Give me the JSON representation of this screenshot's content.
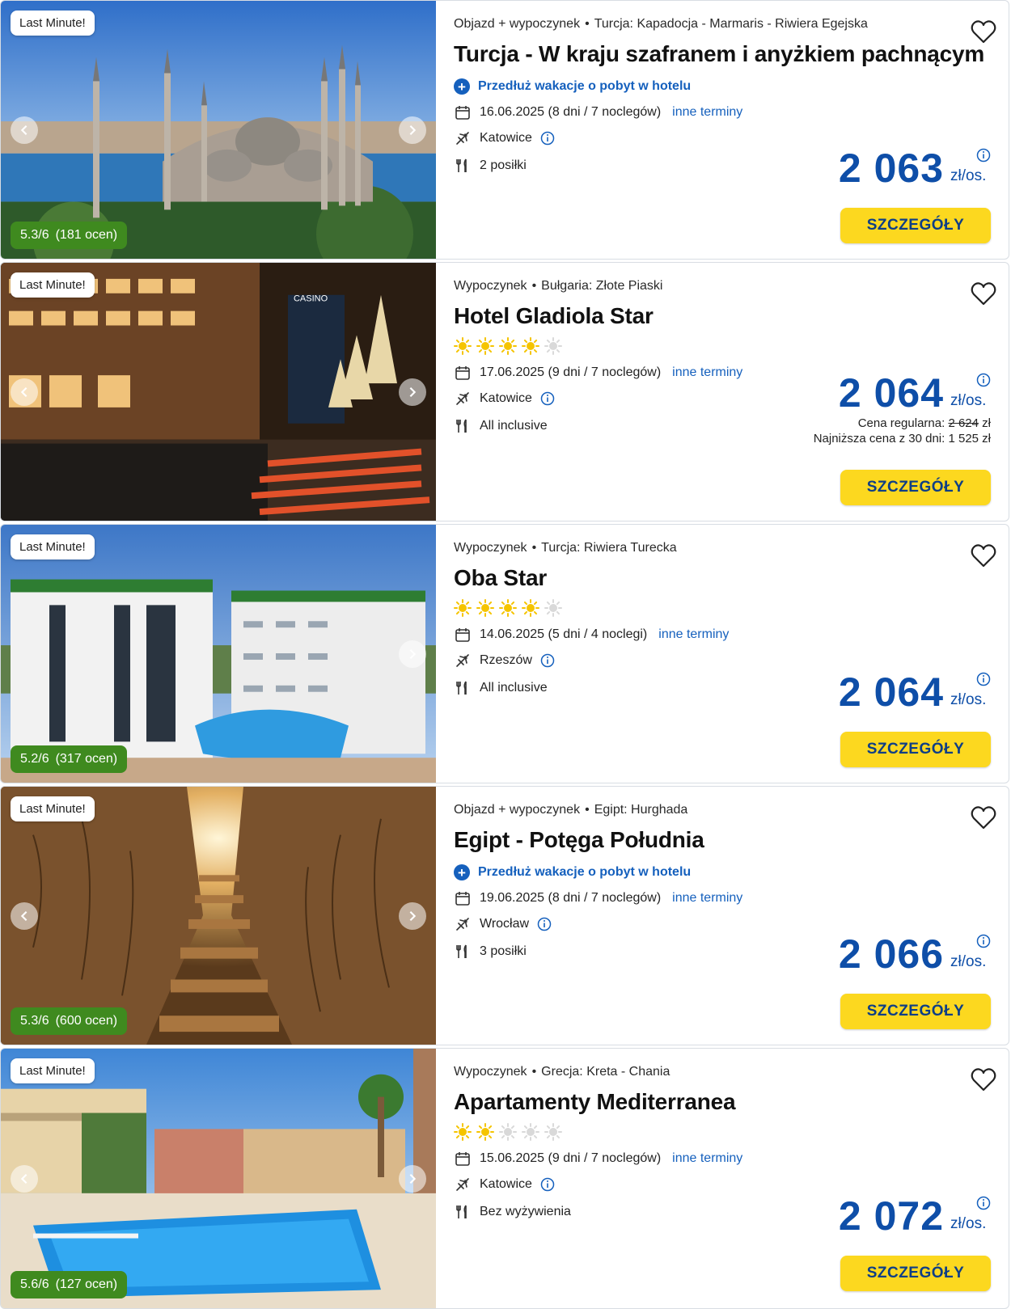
{
  "common": {
    "badge": "Last Minute!",
    "details_label": "SZCZEGÓŁY",
    "other_dates_label": "inne terminy",
    "per_person_label": "zł/os.",
    "extend_label": "Przedłuż wakacje o pobyt w hotelu",
    "dot": "•"
  },
  "offers": [
    {
      "type": "Objazd + wypoczynek",
      "destination": "Turcja: Kapadocja - Marmaris - Riwiera Egejska",
      "title": "Turcja - W kraju szafranem i anyżkiem pachnącym",
      "stars": 0,
      "extend": true,
      "date": "16.06.2025 (8 dni / 7 noclegów)",
      "departure": "Katowice",
      "meals": "2 posiłki",
      "price": "2 063",
      "rating": "5.3/6",
      "rating_count": "(181 ocen)",
      "regular_price_label": "",
      "regular_price": "",
      "lowest_price": ""
    },
    {
      "type": "Wypoczynek",
      "destination": "Bułgaria: Złote Piaski",
      "title": "Hotel Gladiola Star",
      "stars": 4,
      "extend": false,
      "date": "17.06.2025 (9 dni / 7 noclegów)",
      "departure": "Katowice",
      "meals": "All inclusive",
      "price": "2 064",
      "rating": "",
      "rating_count": "",
      "regular_price_label": "Cena regularna:",
      "regular_price": "2 624",
      "regular_price_currency": "zł",
      "lowest_price": "Najniższa cena z 30 dni: 1 525 zł"
    },
    {
      "type": "Wypoczynek",
      "destination": "Turcja: Riwiera Turecka",
      "title": "Oba Star",
      "stars": 4,
      "extend": false,
      "date": "14.06.2025 (5 dni / 4 noclegi)",
      "departure": "Rzeszów",
      "meals": "All inclusive",
      "price": "2 064",
      "rating": "5.2/6",
      "rating_count": "(317 ocen)",
      "regular_price_label": "",
      "regular_price": "",
      "lowest_price": ""
    },
    {
      "type": "Objazd + wypoczynek",
      "destination": "Egipt: Hurghada",
      "title": "Egipt - Potęga Południa",
      "stars": 0,
      "extend": true,
      "date": "19.06.2025 (8 dni / 7 noclegów)",
      "departure": "Wrocław",
      "meals": "3 posiłki",
      "price": "2 066",
      "rating": "5.3/6",
      "rating_count": "(600 ocen)",
      "regular_price_label": "",
      "regular_price": "",
      "lowest_price": ""
    },
    {
      "type": "Wypoczynek",
      "destination": "Grecja: Kreta - Chania",
      "title": "Apartamenty Mediterranea",
      "stars": 2,
      "extend": false,
      "date": "15.06.2025 (9 dni / 7 noclegów)",
      "departure": "Katowice",
      "meals": "Bez wyżywienia",
      "price": "2 072",
      "rating": "5.6/6",
      "rating_count": "(127 ocen)",
      "regular_price_label": "",
      "regular_price": "",
      "lowest_price": ""
    }
  ],
  "colors": {
    "accent_blue": "#0e4ea8",
    "link_blue": "#1560bd",
    "button_yellow": "#fcd81f",
    "rating_green": "#3f8a1f",
    "star_yellow": "#f5c400",
    "star_grey": "#d9d9d9"
  },
  "icons": [
    "calendar-icon",
    "plane-icon",
    "cutlery-icon",
    "info-icon",
    "heart-icon",
    "plus-icon",
    "sun-star-icon",
    "chevron-left-icon",
    "chevron-right-icon"
  ]
}
